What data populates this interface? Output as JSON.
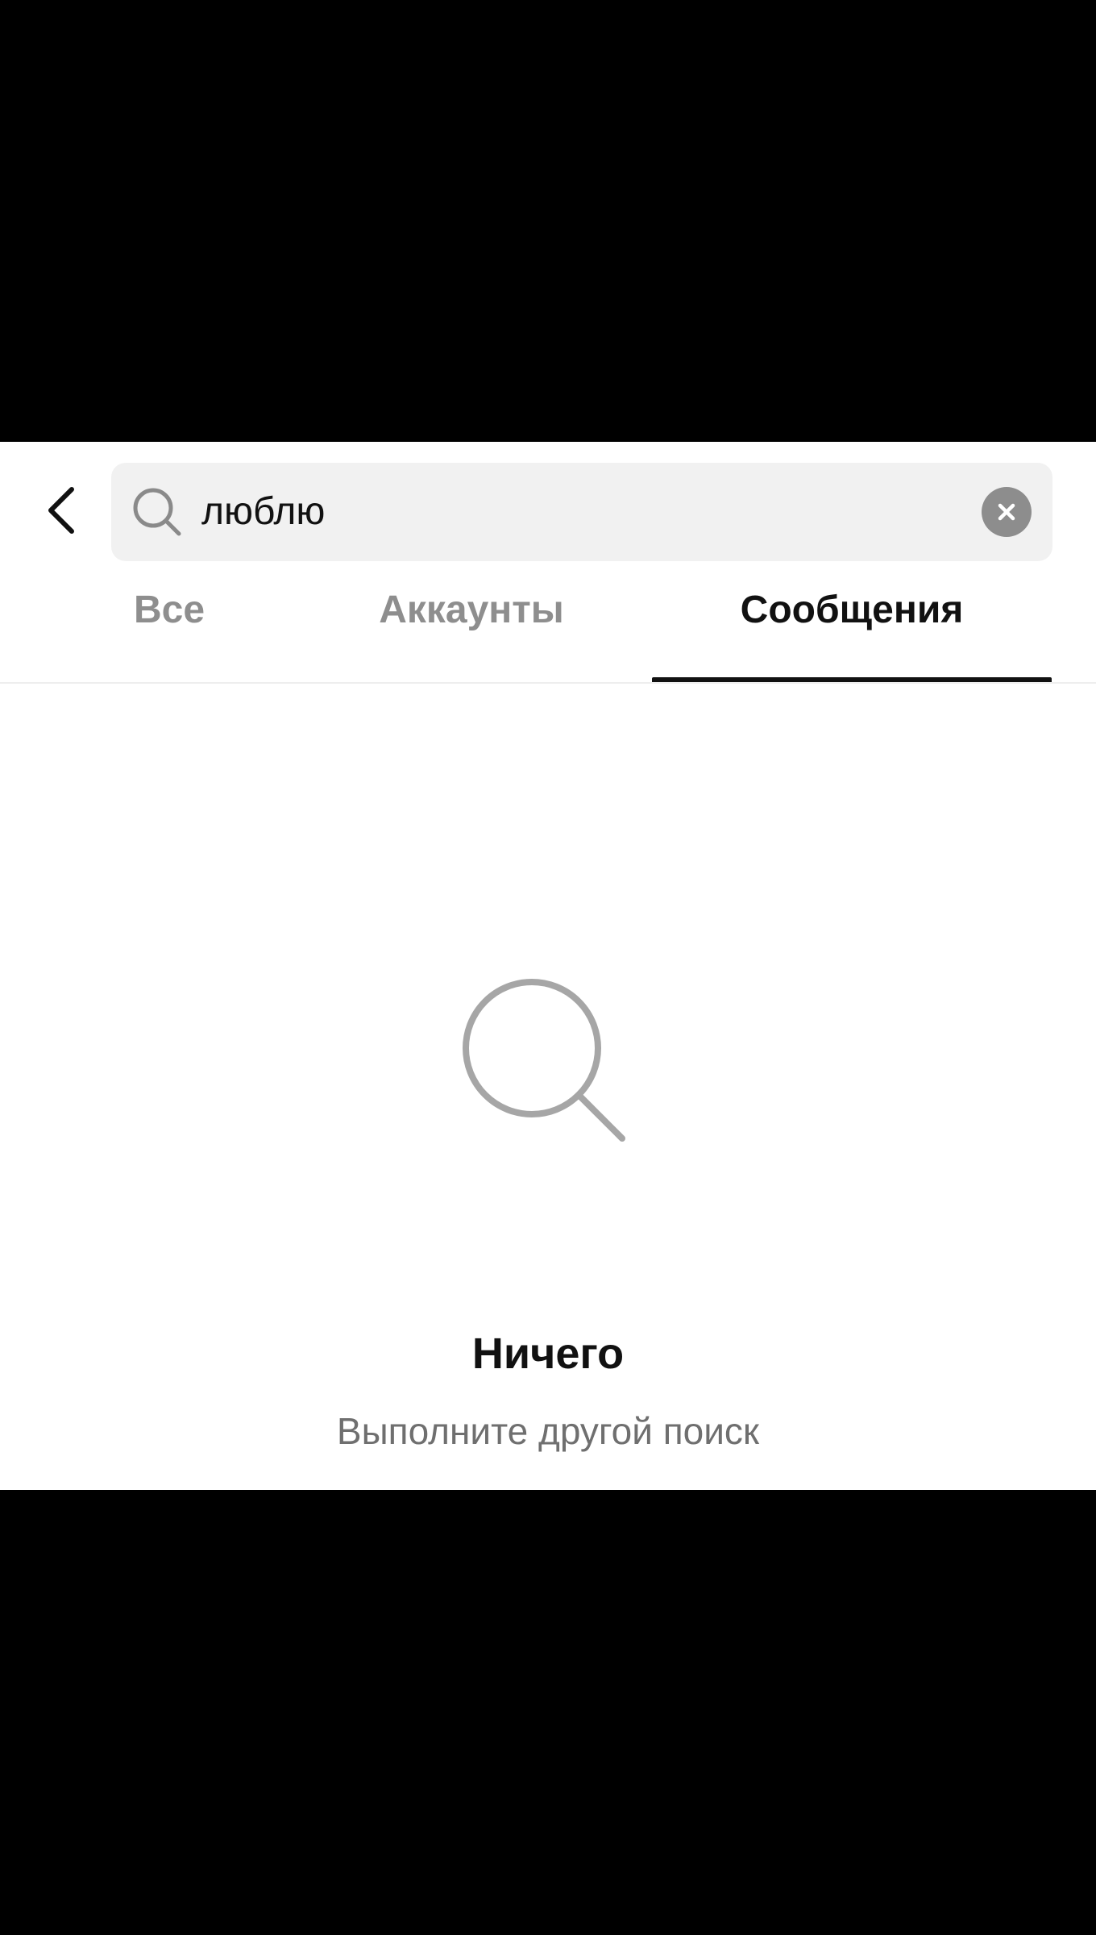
{
  "search": {
    "value": "люблю",
    "icon": "search-icon",
    "clear_icon": "clear-icon"
  },
  "header": {
    "back_icon": "chevron-left-icon"
  },
  "tabs": [
    {
      "label": "Все",
      "active": false
    },
    {
      "label": "Аккаунты",
      "active": false
    },
    {
      "label": "Сообщения",
      "active": true
    }
  ],
  "empty_state": {
    "icon": "search-icon",
    "title": "Ничего",
    "subtitle": "Выполните другой поиск"
  },
  "colors": {
    "background": "#ffffff",
    "letterbox": "#000000",
    "active_tab": "#111111",
    "inactive_tab": "#8e8e8e",
    "search_field_bg": "#f1f1f1",
    "empty_icon": "#a6a6a6",
    "subtitle": "#6f6f6f"
  }
}
